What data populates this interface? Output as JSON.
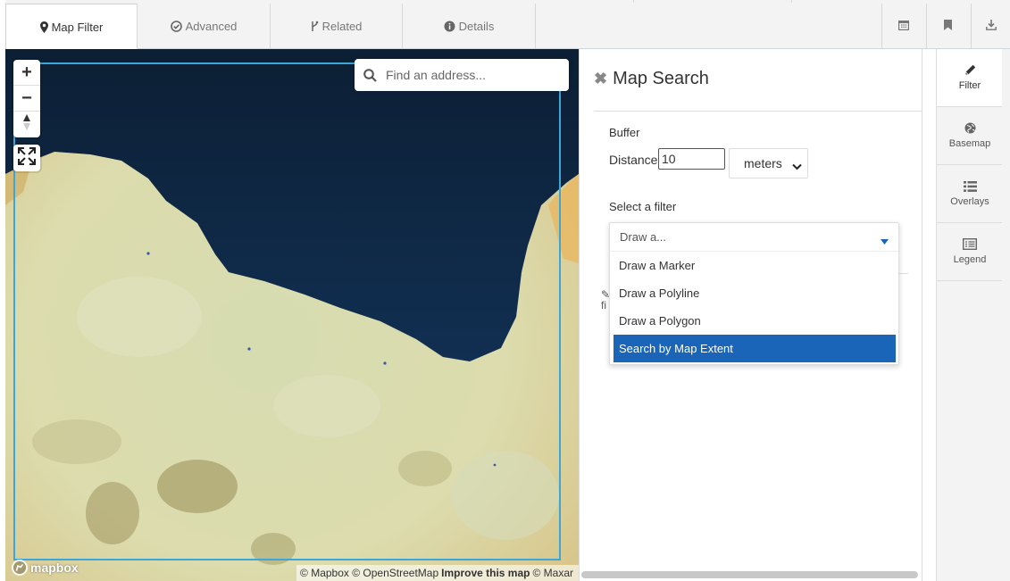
{
  "tabs": [
    {
      "label": "Map Filter",
      "icon": "map-marker-icon"
    },
    {
      "label": "Advanced",
      "icon": "check-circle-icon"
    },
    {
      "label": "Related",
      "icon": "branch-icon"
    },
    {
      "label": "Details",
      "icon": "info-circle-icon"
    }
  ],
  "toolbar": {
    "icons": [
      "calendar-icon",
      "bookmark-icon",
      "download-icon"
    ]
  },
  "map": {
    "search_placeholder": "Find an address...",
    "zoom_in": "+",
    "zoom_out": "−",
    "logo": "mapbox",
    "attribution": {
      "mapbox": "© Mapbox",
      "osm": "© OpenStreetMap",
      "improve": "Improve this map",
      "maxar": "© Maxar"
    }
  },
  "panel": {
    "title": "Map Search",
    "buffer_label": "Buffer",
    "distance_label": "Distance",
    "distance_value": "10",
    "units_value": "meters",
    "filter_label": "Select a filter",
    "filter_placeholder": "Draw a...",
    "filter_options": [
      "Draw a Marker",
      "Draw a Polyline",
      "Draw a Polygon",
      "Search by Map Extent"
    ],
    "selected_option": "Search by Map Extent",
    "partial_text_1": "✎",
    "partial_text_2": "fi"
  },
  "rail": [
    {
      "label": "Filter",
      "icon": "pencil-icon"
    },
    {
      "label": "Basemap",
      "icon": "globe-icon"
    },
    {
      "label": "Overlays",
      "icon": "list-icon"
    },
    {
      "label": "Legend",
      "icon": "legend-icon"
    }
  ],
  "colors": {
    "accent": "#1a65b7",
    "sea": "#0f2b4a",
    "extent_outline": "#3aa6d9"
  }
}
